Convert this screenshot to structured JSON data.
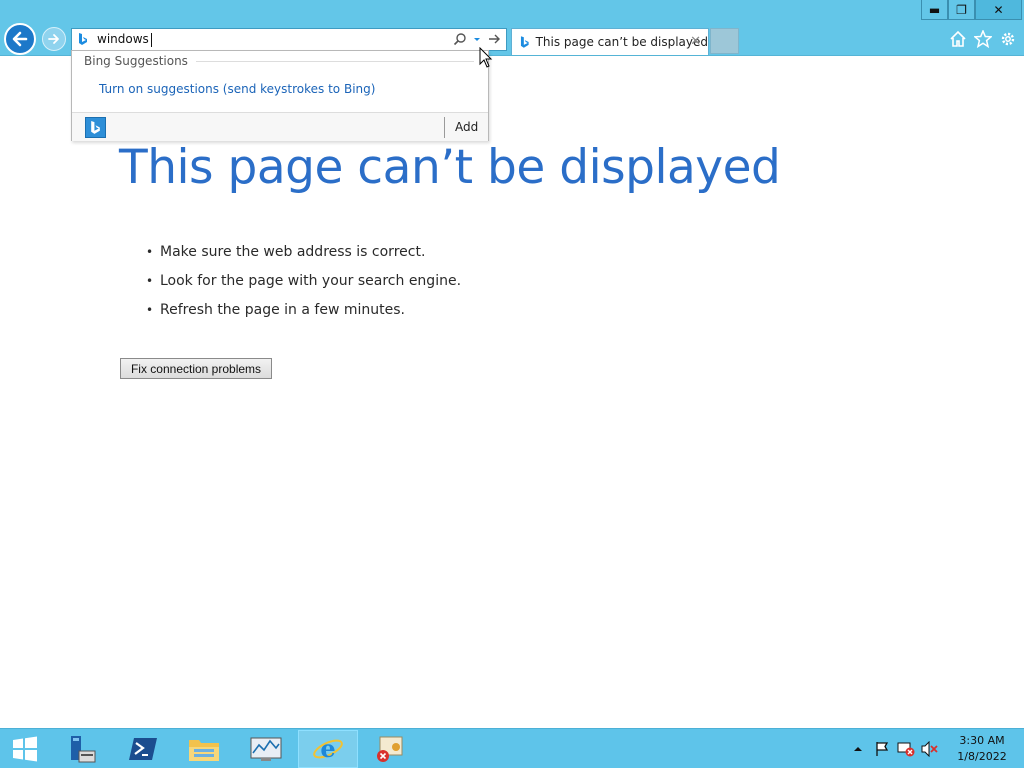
{
  "window": {
    "minimize_glyph": "▬",
    "restore_glyph": "❐",
    "close_glyph": "✕"
  },
  "address_bar": {
    "value": "windows",
    "icons": [
      "bing-icon",
      "search-icon",
      "dropdown-arrow-icon",
      "go-arrow-icon"
    ]
  },
  "tab": {
    "title": "This page can’t be displayed",
    "close_glyph": "✕"
  },
  "toolbar_icons": [
    "home-icon",
    "favorites-star-icon",
    "settings-gear-icon"
  ],
  "dropdown": {
    "section_label": "Bing Suggestions",
    "suggestion_link": "Turn on suggestions (send keystrokes to Bing)",
    "add_label": "Add"
  },
  "page": {
    "headline": "This page can’t be displayed",
    "tips": [
      "Make sure the web address is correct.",
      "Look for the page with your search engine.",
      "Refresh the page in a few minutes."
    ],
    "fix_button": "Fix connection problems"
  },
  "taskbar": {
    "apps": [
      "server-manager-icon",
      "powershell-icon",
      "file-explorer-icon",
      "performance-monitor-icon",
      "internet-explorer-icon",
      "certificate-error-icon"
    ],
    "active_app": "internet-explorer-icon",
    "tray_icons": [
      "show-hidden-icons-arrow",
      "action-center-flag-icon",
      "network-error-icon",
      "volume-muted-icon"
    ],
    "time": "3:30 AM",
    "date": "1/8/2022"
  },
  "colors": {
    "chrome": "#63c6e8",
    "headline": "#2b6ec8",
    "link": "#1b64b8",
    "taskbar": "#5ec4ea"
  }
}
